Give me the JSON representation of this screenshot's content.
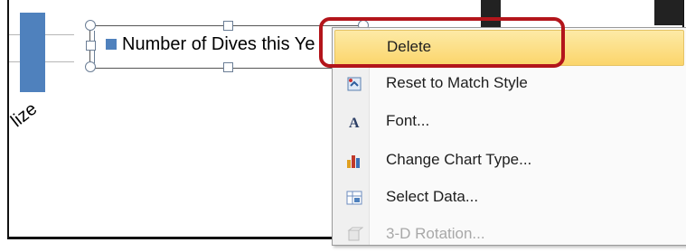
{
  "chart": {
    "legend_label": "Number of Dives this Ye",
    "axis_partial_label": "lize",
    "series_color": "#4f81bd"
  },
  "context_menu": {
    "items": [
      {
        "label": "Delete",
        "icon": "none",
        "highlighted": true,
        "disabled": false
      },
      {
        "label": "Reset to Match Style",
        "icon": "reset-style-icon",
        "highlighted": false,
        "disabled": false
      },
      {
        "label": "Font...",
        "icon": "font-icon",
        "highlighted": false,
        "disabled": false
      },
      {
        "label": "Change Chart Type...",
        "icon": "chart-type-icon",
        "highlighted": false,
        "disabled": false
      },
      {
        "label": "Select Data...",
        "icon": "select-data-icon",
        "highlighted": false,
        "disabled": false
      },
      {
        "label": "3-D Rotation...",
        "icon": "3d-rotation-icon",
        "highlighted": false,
        "disabled": true
      }
    ],
    "highlight_color": "#fbd56b"
  },
  "callout_color": "#b3151b"
}
